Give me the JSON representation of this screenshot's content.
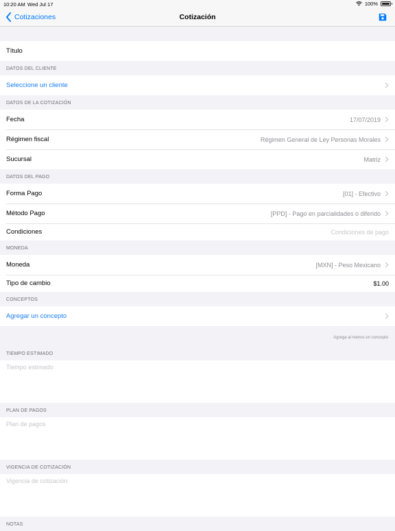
{
  "status": {
    "time": "10:20 AM",
    "date": "Wed Jul 17",
    "battery": "100%"
  },
  "nav": {
    "back_label": "Cotizaciones",
    "title": "Cotización"
  },
  "titulo": {
    "label": "Título"
  },
  "cliente": {
    "header": "Datos del cliente",
    "select_label": "Seleccione un cliente"
  },
  "cotizacion": {
    "header": "Datos de la cotización",
    "fecha_label": "Fecha",
    "fecha_value": "17/07/2019",
    "regimen_label": "Régimen fiscal",
    "regimen_value": "Régimen General de Ley Personas Morales",
    "sucursal_label": "Sucursal",
    "sucursal_value": "Matriz"
  },
  "pago": {
    "header": "Datos del pago",
    "forma_label": "Forma Pago",
    "forma_value": "[01] - Efectivo",
    "metodo_label": "Método Pago",
    "metodo_value": "[PPD] - Pago en parcialidades o diferido",
    "condiciones_label": "Condiciones",
    "condiciones_placeholder": "Condiciones de pago"
  },
  "moneda": {
    "header": "Moneda",
    "moneda_label": "Moneda",
    "moneda_value": "[MXN] - Peso Mexicano",
    "cambio_label": "Tipo de cambio",
    "cambio_value": "$1.00"
  },
  "conceptos": {
    "header": "Conceptos",
    "add_label": "Agregar un concepto",
    "footer": "Agrega al menos un concepto"
  },
  "tiempo": {
    "header": "Tiempo estimado",
    "placeholder": "Tiempo estimado"
  },
  "plan": {
    "header": "Plan de pagos",
    "placeholder": "Plan de pagos"
  },
  "vigencia": {
    "header": "Vigencia de cotización",
    "placeholder": "Vigencia de cotización"
  },
  "notas": {
    "header": "Notas"
  },
  "colors": {
    "accent": "#007aff",
    "link": "#1a7ef3",
    "background": "#f2f2f7",
    "secondary_text": "#8e8e93",
    "placeholder": "#c7c7cc"
  }
}
